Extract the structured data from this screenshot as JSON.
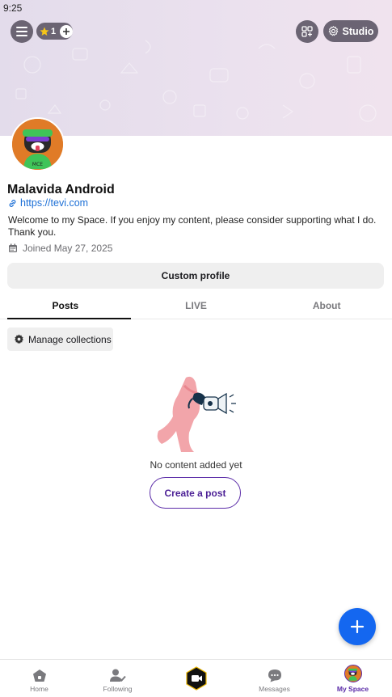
{
  "status": {
    "time": "9:25"
  },
  "header": {
    "coin_count": "1",
    "studio_label": "Studio"
  },
  "profile": {
    "name": "Malavida Android",
    "link": "https://tevi.com",
    "bio": "Welcome to my Space. If you enjoy my content, please consider supporting what I do. Thank you.",
    "joined": "Joined May 27, 2025",
    "custom_profile_label": "Custom profile"
  },
  "tabs": [
    {
      "label": "Posts",
      "active": true
    },
    {
      "label": "LIVE",
      "active": false
    },
    {
      "label": "About",
      "active": false
    }
  ],
  "collections": {
    "manage_label": "Manage collections"
  },
  "empty_state": {
    "message": "No content added yet",
    "create_label": "Create a post"
  },
  "bottom_nav": [
    {
      "label": "Home",
      "icon": "home-icon"
    },
    {
      "label": "Following",
      "icon": "following-icon"
    },
    {
      "label": "",
      "icon": "live-camera-icon"
    },
    {
      "label": "Messages",
      "icon": "messages-icon"
    },
    {
      "label": "My Space",
      "icon": "avatar",
      "active": true
    }
  ],
  "colors": {
    "accent": "#5b2ca8",
    "fab": "#1467f0",
    "link": "#1c6fd6",
    "avatar_bg": "#e07b27"
  }
}
